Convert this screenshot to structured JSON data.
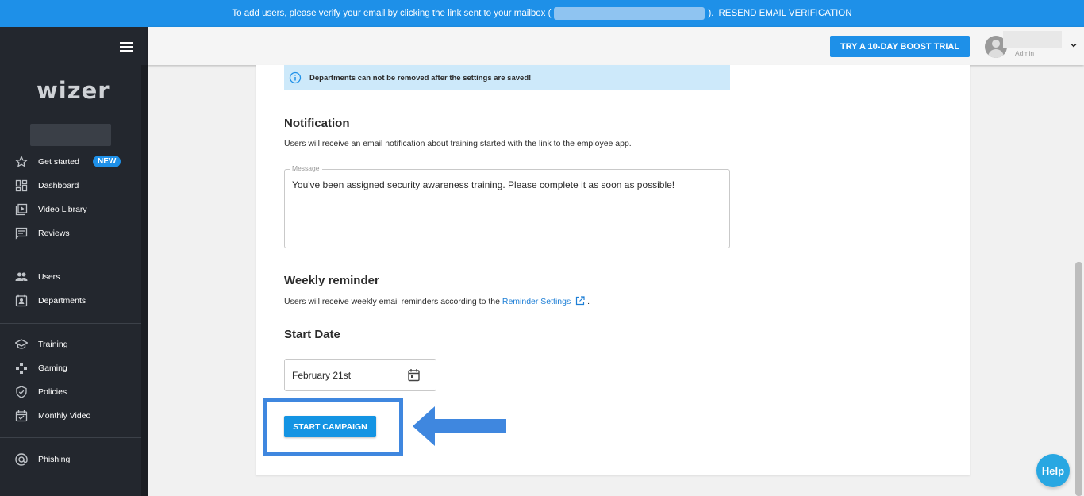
{
  "banner": {
    "text_before": "To add users, please verify your email by clicking the link sent to your mailbox (",
    "text_after": ").",
    "resend_link": "RESEND EMAIL VERIFICATION"
  },
  "sidebar": {
    "logo": "wizer",
    "items": [
      {
        "label": "Get started",
        "icon": "star-icon",
        "badge": "NEW"
      },
      {
        "label": "Dashboard",
        "icon": "dashboard-icon"
      },
      {
        "label": "Video Library",
        "icon": "video-library-icon"
      },
      {
        "label": "Reviews",
        "icon": "reviews-icon"
      },
      {
        "label": "Users",
        "icon": "users-icon"
      },
      {
        "label": "Departments",
        "icon": "departments-icon"
      },
      {
        "label": "Training",
        "icon": "training-icon"
      },
      {
        "label": "Gaming",
        "icon": "gaming-icon"
      },
      {
        "label": "Policies",
        "icon": "policies-icon"
      },
      {
        "label": "Monthly Video",
        "icon": "monthly-video-icon"
      },
      {
        "label": "Phishing",
        "icon": "phishing-icon"
      }
    ]
  },
  "header": {
    "boost_button": "TRY A 10-DAY BOOST TRIAL",
    "user_role": "Admin"
  },
  "main": {
    "info_text": "Departments can not be removed after the settings are saved!",
    "notification": {
      "title": "Notification",
      "description": "Users will receive an email notification about training started with the link to the employee app.",
      "message_label": "Message",
      "message_value": "You've been assigned security awareness training. Please complete it as soon as possible!"
    },
    "weekly_reminder": {
      "title": "Weekly reminder",
      "description_before": "Users will receive weekly email reminders according to the ",
      "link": "Reminder Settings",
      "description_after": " ."
    },
    "start_date": {
      "title": "Start Date",
      "value": "February 21st"
    },
    "start_button": "START CAMPAIGN"
  },
  "help_button": "Help",
  "colors": {
    "primary": "#1e90e8",
    "sidebar_bg": "#23272e",
    "info_bg": "#cde9fa",
    "highlight": "#3f87df"
  }
}
